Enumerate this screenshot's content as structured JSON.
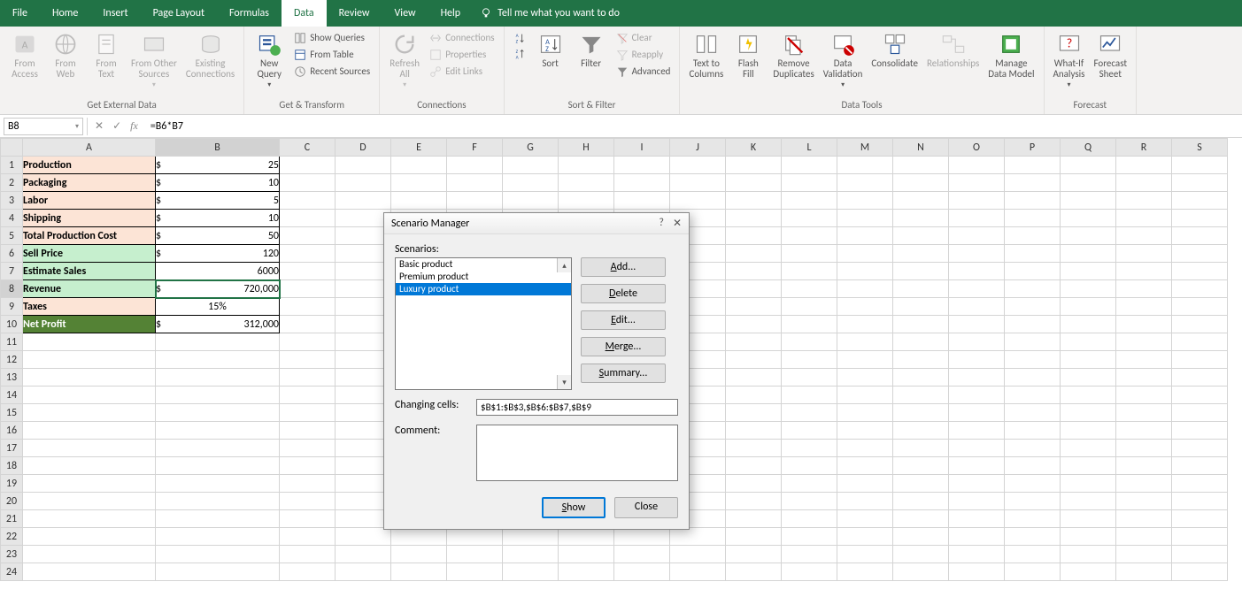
{
  "menu": {
    "tabs": [
      "File",
      "Home",
      "Insert",
      "Page Layout",
      "Formulas",
      "Data",
      "Review",
      "View",
      "Help"
    ],
    "active": "Data",
    "tellme": "Tell me what you want to do"
  },
  "ribbon": {
    "groups": {
      "get_external": {
        "label": "Get External Data",
        "from_access": "From\nAccess",
        "from_web": "From\nWeb",
        "from_text": "From\nText",
        "from_other": "From Other\nSources",
        "existing": "Existing\nConnections"
      },
      "get_transform": {
        "label": "Get & Transform",
        "new_query": "New\nQuery",
        "show_queries": "Show Queries",
        "from_table": "From Table",
        "recent_sources": "Recent Sources"
      },
      "connections": {
        "label": "Connections",
        "refresh": "Refresh\nAll",
        "conns": "Connections",
        "properties": "Properties",
        "edit_links": "Edit Links"
      },
      "sort_filter": {
        "label": "Sort & Filter",
        "sort": "Sort",
        "filter": "Filter",
        "clear": "Clear",
        "reapply": "Reapply",
        "advanced": "Advanced"
      },
      "data_tools": {
        "label": "Data Tools",
        "text_to_cols": "Text to\nColumns",
        "flash_fill": "Flash\nFill",
        "remove_dup": "Remove\nDuplicates",
        "data_val": "Data\nValidation",
        "consolidate": "Consolidate",
        "relationships": "Relationships",
        "manage_dm": "Manage\nData Model"
      },
      "forecast": {
        "label": "Forecast",
        "what_if": "What-If\nAnalysis",
        "forecast_sheet": "Forecast\nSheet"
      }
    }
  },
  "formula_bar": {
    "namebox": "B8",
    "formula": "=B6*B7"
  },
  "columns": [
    "A",
    "B",
    "C",
    "D",
    "E",
    "F",
    "G",
    "H",
    "I",
    "J",
    "K",
    "L",
    "M",
    "N",
    "O",
    "P",
    "Q",
    "R",
    "S"
  ],
  "sheet": {
    "rows": [
      {
        "n": 1,
        "a": "Production",
        "b": "25",
        "cls": "peach",
        "dollar": true
      },
      {
        "n": 2,
        "a": "Packaging",
        "b": "10",
        "cls": "peach",
        "dollar": true
      },
      {
        "n": 3,
        "a": "Labor",
        "b": "5",
        "cls": "peach",
        "dollar": true
      },
      {
        "n": 4,
        "a": "Shipping",
        "b": "10",
        "cls": "peach",
        "dollar": true
      },
      {
        "n": 5,
        "a": "Total Production Cost",
        "b": "50",
        "cls": "peach",
        "dollar": true
      },
      {
        "n": 6,
        "a": "Sell Price",
        "b": "120",
        "cls": "lightgreen",
        "dollar": true
      },
      {
        "n": 7,
        "a": "Estimate Sales",
        "b": "6000",
        "cls": "lightgreen",
        "dollar": false
      },
      {
        "n": 8,
        "a": "Revenue",
        "b": "720,000",
        "cls": "lightgreen",
        "dollar": true,
        "selected": true
      },
      {
        "n": 9,
        "a": "Taxes",
        "b": "15%",
        "cls": "peach",
        "dollar": false,
        "center": true
      },
      {
        "n": 10,
        "a": "Net Profit",
        "b": "312,000",
        "cls": "darkgreen",
        "dollar": true
      }
    ],
    "empty_rows": [
      11,
      12,
      13,
      14,
      15,
      16,
      17,
      18,
      19,
      20,
      21,
      22,
      23,
      24
    ]
  },
  "dialog": {
    "title": "Scenario Manager",
    "scenarios_label": "Scenarios:",
    "items": [
      "Basic product",
      "Premium product",
      "Luxury product"
    ],
    "selected_index": 2,
    "buttons": {
      "add": "Add...",
      "delete": "Delete",
      "edit": "Edit...",
      "merge": "Merge...",
      "summary": "Summary..."
    },
    "changing_cells_label": "Changing cells:",
    "changing_cells_value": "$B$1:$B$3,$B$6:$B$7,$B$9",
    "comment_label": "Comment:",
    "comment_value": "",
    "show": "Show",
    "close": "Close"
  }
}
